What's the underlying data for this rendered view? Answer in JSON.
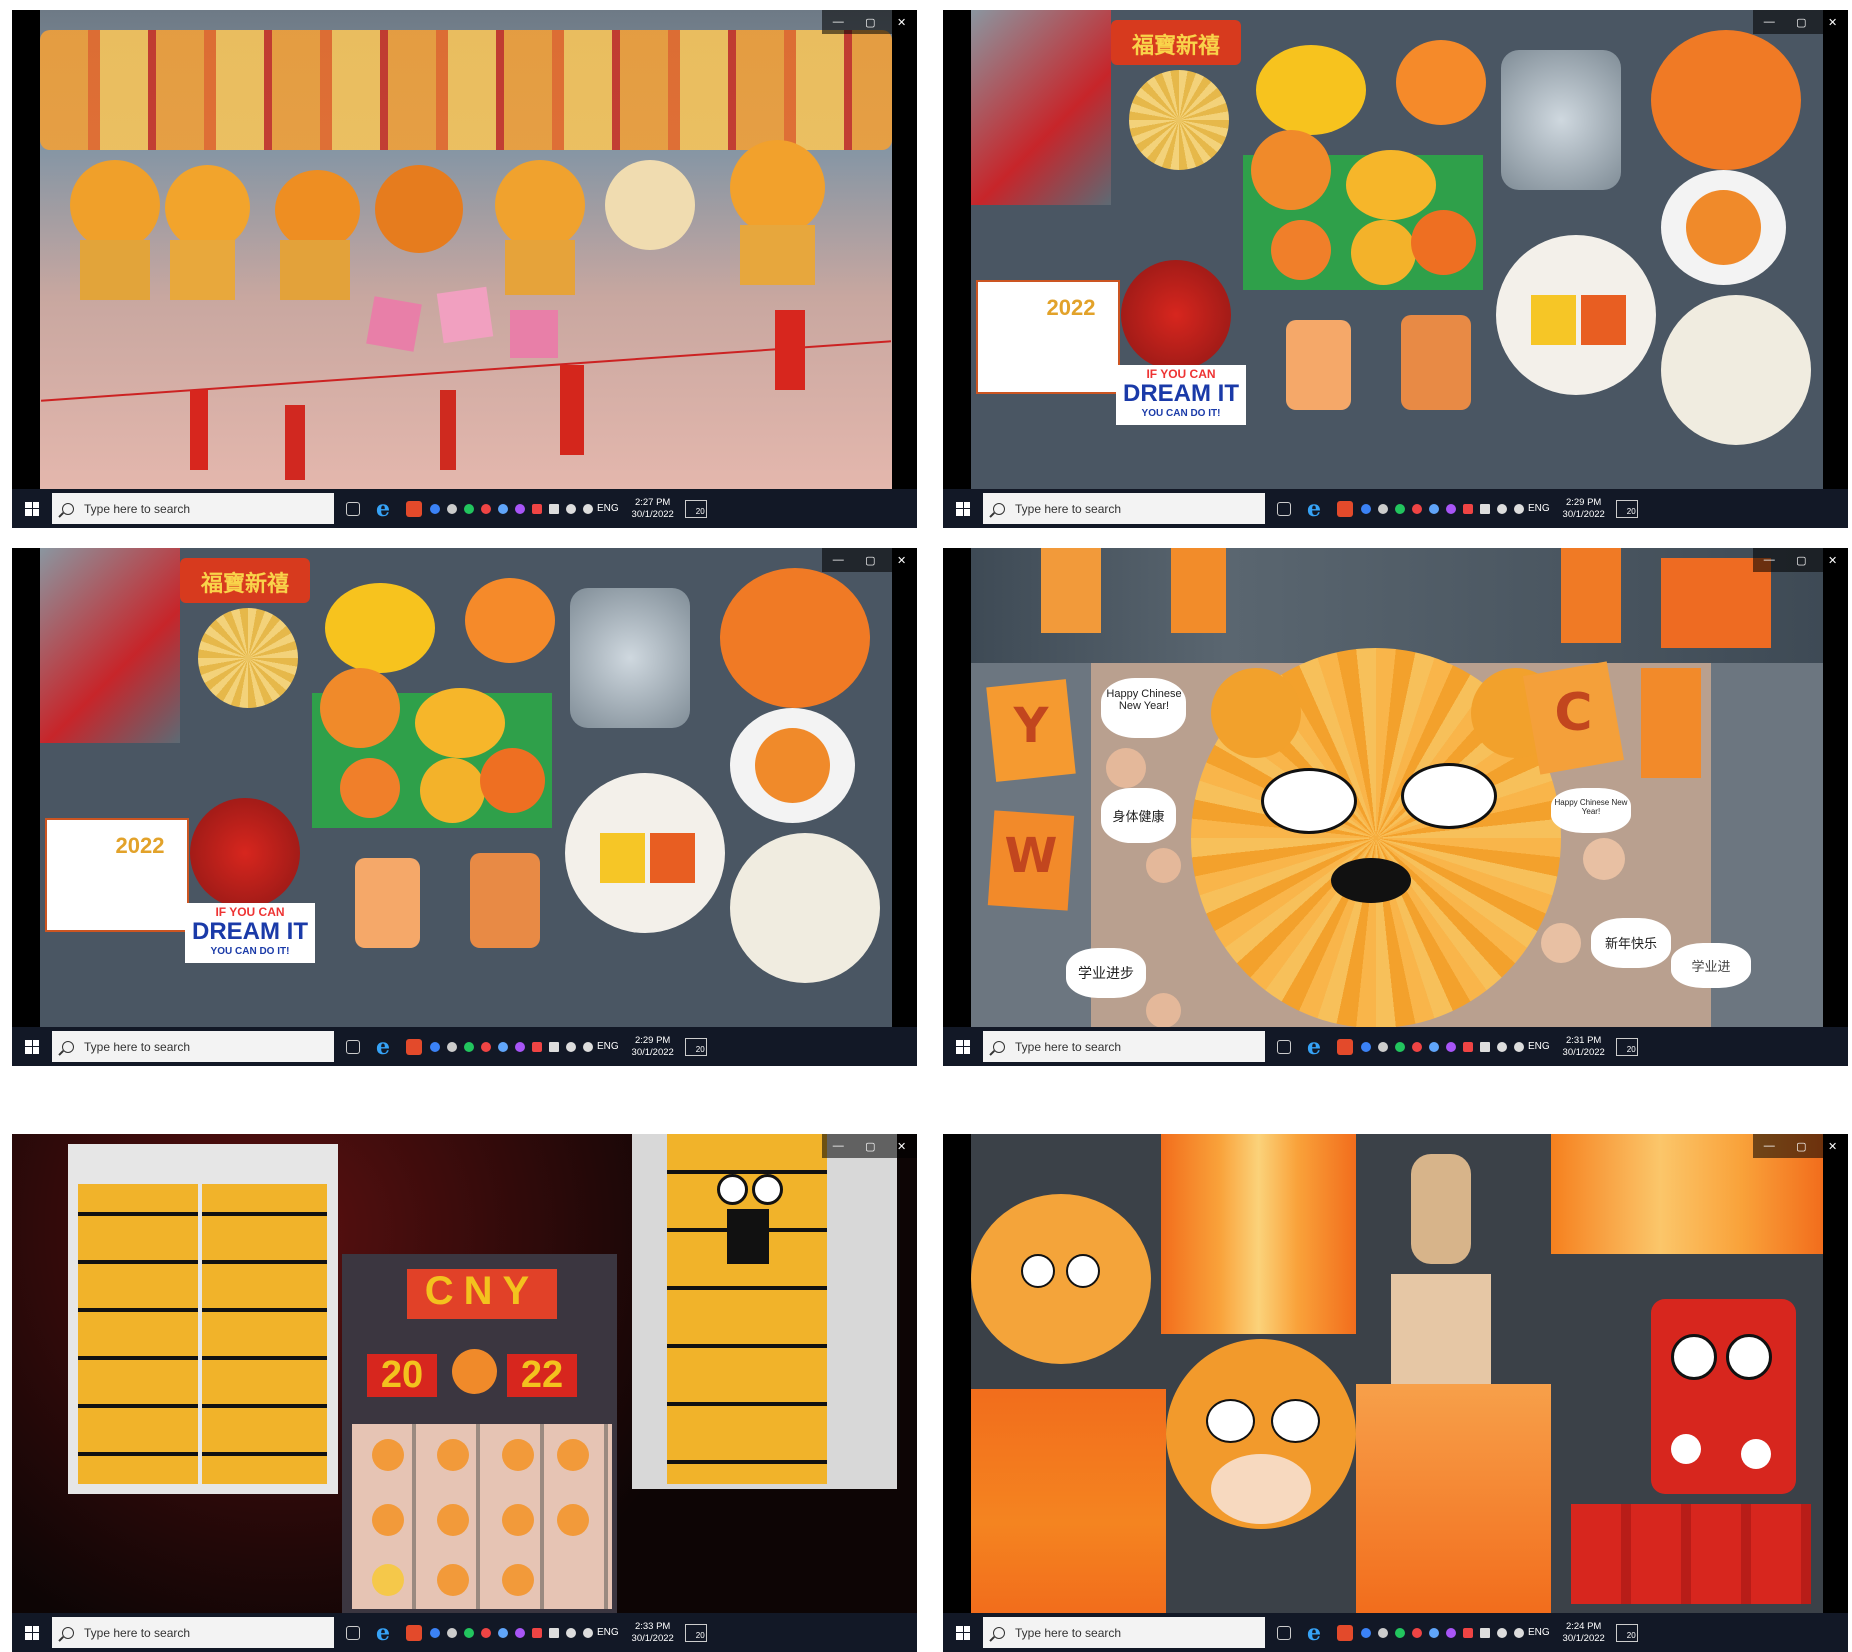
{
  "window": {
    "minimize_glyph": "—",
    "restore_glyph": "▢",
    "close_glyph": "✕"
  },
  "taskbar": {
    "search_placeholder": "Type here to search",
    "language": "ENG",
    "notification_count": "20"
  },
  "screenshots": [
    {
      "time": "2:27 PM",
      "date": "30/1/2022"
    },
    {
      "time": "2:29 PM",
      "date": "30/1/2022"
    },
    {
      "time": "2:29 PM",
      "date": "30/1/2022"
    },
    {
      "time": "2:31 PM",
      "date": "30/1/2022"
    },
    {
      "time": "2:33 PM",
      "date": "30/1/2022"
    },
    {
      "time": "2:24 PM",
      "date": "30/1/2022"
    }
  ],
  "art_text": {
    "banner_chinese": "福寶新禧",
    "year": "2022",
    "slogan_top": "IF YOU CAN",
    "slogan_main": "DREAM IT",
    "slogan_bottom": "YOU CAN DO IT!",
    "letter_y": "Y",
    "letter_c": "C",
    "letter_w": "W",
    "bubble_happy": "Happy Chinese New Year!",
    "bubble_health": "身体健康",
    "bubble_study": "学业进步",
    "bubble_study_2": "学业进",
    "bubble_wish": "新年快乐",
    "bubble_happy_small": "Happy Chinese New Year!",
    "cny": "CNY",
    "year_left": "20",
    "year_right": "22"
  },
  "colors": {
    "taskbar": "#121826",
    "tiger_orange": "#f08a24",
    "paper_yellow": "#f5b51e",
    "festive_red": "#d7261e"
  }
}
